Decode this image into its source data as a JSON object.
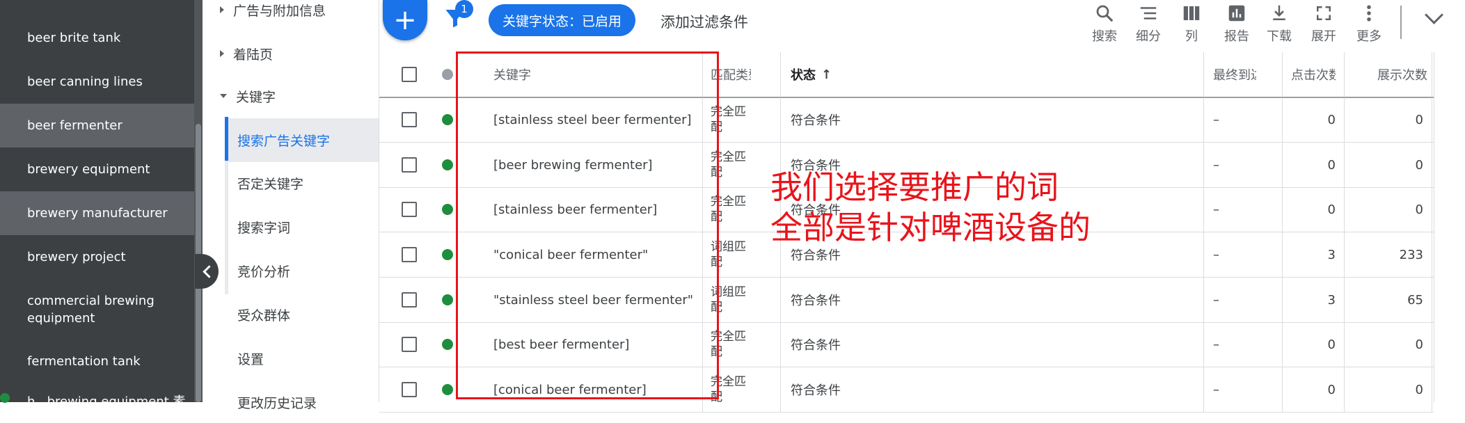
{
  "sidebar": {
    "items": [
      {
        "label": "beer brite tank",
        "highlight": false
      },
      {
        "label": "beer canning lines",
        "highlight": false
      },
      {
        "label": "beer fermenter",
        "highlight": true
      },
      {
        "label": "brewery equipment",
        "highlight": false
      },
      {
        "label": "brewery manufacturer",
        "highlight": true
      },
      {
        "label": "brewery project",
        "highlight": false
      },
      {
        "label": "commercial brewing equipment",
        "highlight": false
      },
      {
        "label": "fermentation tank",
        "highlight": false
      },
      {
        "label": "h...brewing equipment 素",
        "highlight": false
      }
    ]
  },
  "nav": {
    "items": [
      {
        "label": "广告与附加信息",
        "type": "parent",
        "expanded": false
      },
      {
        "label": "着陆页",
        "type": "parent",
        "expanded": false
      },
      {
        "label": "关键字",
        "type": "parent",
        "expanded": true
      },
      {
        "label": "搜索广告关键字",
        "type": "child",
        "active": true
      },
      {
        "label": "否定关键字",
        "type": "child"
      },
      {
        "label": "搜索字词",
        "type": "child"
      },
      {
        "label": "竞价分析",
        "type": "child"
      },
      {
        "label": "受众群体",
        "type": "child"
      },
      {
        "label": "设置",
        "type": "child"
      },
      {
        "label": "更改历史记录",
        "type": "child"
      }
    ]
  },
  "toolbar": {
    "filter_badge": "1",
    "status_chip": "关键字状态：已启用",
    "add_filter": "添加过滤条件",
    "buttons": [
      {
        "icon": "search-icon",
        "label": "搜索"
      },
      {
        "icon": "segment-icon",
        "label": "细分"
      },
      {
        "icon": "columns-icon",
        "label": "列"
      },
      {
        "icon": "report-icon",
        "label": "报告"
      },
      {
        "icon": "download-icon",
        "label": "下载"
      },
      {
        "icon": "expand-icon",
        "label": "展开"
      },
      {
        "icon": "more-icon",
        "label": "更多"
      }
    ]
  },
  "table": {
    "headers": {
      "keyword": "关键字",
      "match_type": "匹配类型",
      "status": "状态",
      "last": "最终到达网址",
      "clicks": "点击次数",
      "impressions": "展示次数"
    },
    "rows": [
      {
        "keyword": "[stainless steel beer fermenter]",
        "match": "完全匹配",
        "status": "符合条件",
        "last": "–",
        "clicks": "0",
        "impressions": "0"
      },
      {
        "keyword": "[beer brewing fermenter]",
        "match": "完全匹配",
        "status": "符合条件",
        "last": "–",
        "clicks": "0",
        "impressions": "0"
      },
      {
        "keyword": "[stainless beer fermenter]",
        "match": "完全匹配",
        "status": "符合条件",
        "last": "–",
        "clicks": "0",
        "impressions": "0"
      },
      {
        "keyword": "\"conical beer fermenter\"",
        "match": "词组匹配",
        "status": "符合条件",
        "last": "–",
        "clicks": "3",
        "impressions": "233"
      },
      {
        "keyword": "\"stainless steel beer fermenter\"",
        "match": "词组匹配",
        "status": "符合条件",
        "last": "–",
        "clicks": "3",
        "impressions": "65"
      },
      {
        "keyword": "[best beer fermenter]",
        "match": "完全匹配",
        "status": "符合条件",
        "last": "–",
        "clicks": "0",
        "impressions": "0"
      },
      {
        "keyword": "[conical beer fermenter]",
        "match": "完全匹配",
        "status": "符合条件",
        "last": "–",
        "clicks": "0",
        "impressions": "0"
      }
    ]
  },
  "annotation": {
    "line1": "我们选择要推广的词",
    "line2": "全部是针对啤酒设备的",
    "color": "#e8141b"
  }
}
